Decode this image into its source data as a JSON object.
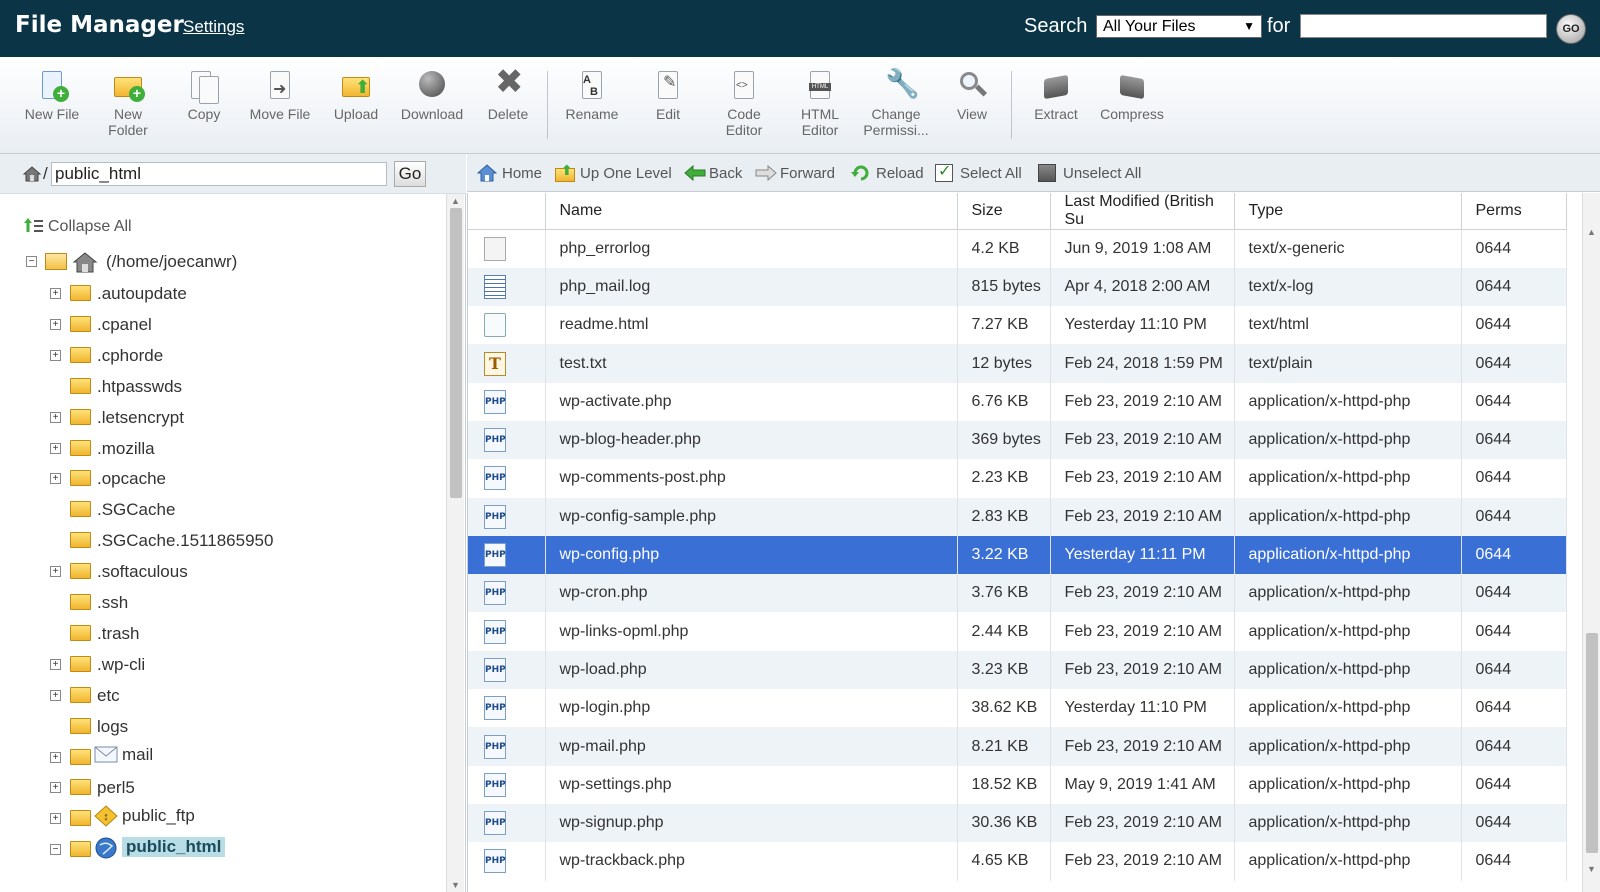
{
  "header": {
    "title": "File Manager",
    "settings_label": "Settings",
    "search_label": "Search",
    "search_scope": "All Your Files",
    "for_label": "for",
    "search_value": "",
    "go_label": "GO"
  },
  "toolbar": {
    "buttons": [
      {
        "label": "New File",
        "icon": "new-file-icon"
      },
      {
        "label": "New Folder",
        "icon": "new-folder-icon"
      },
      {
        "label": "Copy",
        "icon": "copy-icon"
      },
      {
        "label": "Move File",
        "icon": "move-file-icon"
      },
      {
        "label": "Upload",
        "icon": "upload-icon"
      },
      {
        "label": "Download",
        "icon": "download-icon"
      },
      {
        "label": "Delete",
        "icon": "delete-icon"
      },
      {
        "label": "Rename",
        "icon": "rename-icon"
      },
      {
        "label": "Edit",
        "icon": "edit-icon"
      },
      {
        "label": "Code Editor",
        "icon": "code-editor-icon"
      },
      {
        "label": "HTML Editor",
        "icon": "html-editor-icon"
      },
      {
        "label": "Change Permissi...",
        "icon": "permissions-icon"
      },
      {
        "label": "View",
        "icon": "view-icon"
      },
      {
        "label": "Extract",
        "icon": "extract-icon"
      },
      {
        "label": "Compress",
        "icon": "compress-icon"
      }
    ]
  },
  "path_bar": {
    "slash": "/",
    "path_value": "public_html",
    "go_label": "Go"
  },
  "tree": {
    "collapse_all": "Collapse All",
    "root_label": "(/home/joecanwr)",
    "items": [
      {
        "label": ".autoupdate",
        "expandable": true
      },
      {
        "label": ".cpanel",
        "expandable": true
      },
      {
        "label": ".cphorde",
        "expandable": true
      },
      {
        "label": ".htpasswds",
        "expandable": false
      },
      {
        "label": ".letsencrypt",
        "expandable": true
      },
      {
        "label": ".mozilla",
        "expandable": true
      },
      {
        "label": ".opcache",
        "expandable": true
      },
      {
        "label": ".SGCache",
        "expandable": false
      },
      {
        "label": ".SGCache.1511865950",
        "expandable": false
      },
      {
        "label": ".softaculous",
        "expandable": true
      },
      {
        "label": ".ssh",
        "expandable": false
      },
      {
        "label": ".trash",
        "expandable": false
      },
      {
        "label": ".wp-cli",
        "expandable": true
      },
      {
        "label": "etc",
        "expandable": true
      },
      {
        "label": "logs",
        "expandable": false
      },
      {
        "label": "mail",
        "expandable": true,
        "overlay": "mail-icon"
      },
      {
        "label": "perl5",
        "expandable": true
      },
      {
        "label": "public_ftp",
        "expandable": true,
        "overlay": "warning-icon"
      },
      {
        "label": "public_html",
        "expandable": true,
        "expanded": true,
        "overlay": "globe-icon",
        "selected": true
      }
    ]
  },
  "nav": {
    "home": "Home",
    "up": "Up One Level",
    "back": "Back",
    "forward": "Forward",
    "reload": "Reload",
    "select_all": "Select All",
    "unselect_all": "Unselect All"
  },
  "table": {
    "columns": [
      "Name",
      "Size",
      "Last Modified (British Su",
      "Type",
      "Perms"
    ],
    "rows": [
      {
        "name": "php_errorlog",
        "size": "4.2 KB",
        "modified": "Jun 9, 2019 1:08 AM",
        "type": "text/x-generic",
        "perms": "0644",
        "icon": "generic"
      },
      {
        "name": "php_mail.log",
        "size": "815 bytes",
        "modified": "Apr 4, 2018 2:00 AM",
        "type": "text/x-log",
        "perms": "0644",
        "icon": "log"
      },
      {
        "name": "readme.html",
        "size": "7.27 KB",
        "modified": "Yesterday 11:10 PM",
        "type": "text/html",
        "perms": "0644",
        "icon": "html"
      },
      {
        "name": "test.txt",
        "size": "12 bytes",
        "modified": "Feb 24, 2018 1:59 PM",
        "type": "text/plain",
        "perms": "0644",
        "icon": "txt"
      },
      {
        "name": "wp-activate.php",
        "size": "6.76 KB",
        "modified": "Feb 23, 2019 2:10 AM",
        "type": "application/x-httpd-php",
        "perms": "0644",
        "icon": "php"
      },
      {
        "name": "wp-blog-header.php",
        "size": "369 bytes",
        "modified": "Feb 23, 2019 2:10 AM",
        "type": "application/x-httpd-php",
        "perms": "0644",
        "icon": "php"
      },
      {
        "name": "wp-comments-post.php",
        "size": "2.23 KB",
        "modified": "Feb 23, 2019 2:10 AM",
        "type": "application/x-httpd-php",
        "perms": "0644",
        "icon": "php"
      },
      {
        "name": "wp-config-sample.php",
        "size": "2.83 KB",
        "modified": "Feb 23, 2019 2:10 AM",
        "type": "application/x-httpd-php",
        "perms": "0644",
        "icon": "php"
      },
      {
        "name": "wp-config.php",
        "size": "3.22 KB",
        "modified": "Yesterday 11:11 PM",
        "type": "application/x-httpd-php",
        "perms": "0644",
        "icon": "php",
        "selected": true
      },
      {
        "name": "wp-cron.php",
        "size": "3.76 KB",
        "modified": "Feb 23, 2019 2:10 AM",
        "type": "application/x-httpd-php",
        "perms": "0644",
        "icon": "php"
      },
      {
        "name": "wp-links-opml.php",
        "size": "2.44 KB",
        "modified": "Feb 23, 2019 2:10 AM",
        "type": "application/x-httpd-php",
        "perms": "0644",
        "icon": "php"
      },
      {
        "name": "wp-load.php",
        "size": "3.23 KB",
        "modified": "Feb 23, 2019 2:10 AM",
        "type": "application/x-httpd-php",
        "perms": "0644",
        "icon": "php"
      },
      {
        "name": "wp-login.php",
        "size": "38.62 KB",
        "modified": "Yesterday 11:10 PM",
        "type": "application/x-httpd-php",
        "perms": "0644",
        "icon": "php"
      },
      {
        "name": "wp-mail.php",
        "size": "8.21 KB",
        "modified": "Feb 23, 2019 2:10 AM",
        "type": "application/x-httpd-php",
        "perms": "0644",
        "icon": "php"
      },
      {
        "name": "wp-settings.php",
        "size": "18.52 KB",
        "modified": "May 9, 2019 1:41 AM",
        "type": "application/x-httpd-php",
        "perms": "0644",
        "icon": "php"
      },
      {
        "name": "wp-signup.php",
        "size": "30.36 KB",
        "modified": "Feb 23, 2019 2:10 AM",
        "type": "application/x-httpd-php",
        "perms": "0644",
        "icon": "php"
      },
      {
        "name": "wp-trackback.php",
        "size": "4.65 KB",
        "modified": "Feb 23, 2019 2:10 AM",
        "type": "application/x-httpd-php",
        "perms": "0644",
        "icon": "php"
      }
    ]
  },
  "colors": {
    "header_bg": "#0b3546",
    "selected_row": "#3a6fd6",
    "alt_row": "#eef3f8"
  }
}
